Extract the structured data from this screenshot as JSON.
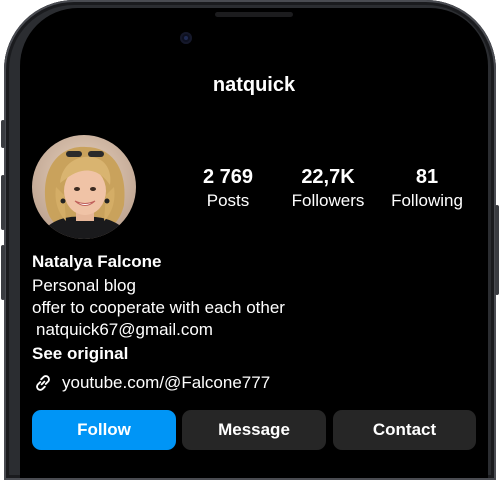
{
  "profile": {
    "username": "natquick",
    "display_name": "Natalya Falcone",
    "avatar_icon": "profile-photo"
  },
  "stats": [
    {
      "value": "2 769",
      "label": "Posts"
    },
    {
      "value": "22,7K",
      "label": "Followers"
    },
    {
      "value": "81",
      "label": "Following"
    }
  ],
  "bio": {
    "line1": "Personal blog",
    "line2": "offer to cooperate with each other",
    "line3": "natquick67@gmail.com",
    "see_original": "See original"
  },
  "link": {
    "icon": "link-icon",
    "text": "youtube.com/@Falcone777"
  },
  "actions": {
    "follow": "Follow",
    "message": "Message",
    "contact": "Contact"
  },
  "colors": {
    "background": "#000000",
    "follow_button": "#0095f6",
    "secondary_button": "#262626",
    "text": "#ffffff"
  }
}
